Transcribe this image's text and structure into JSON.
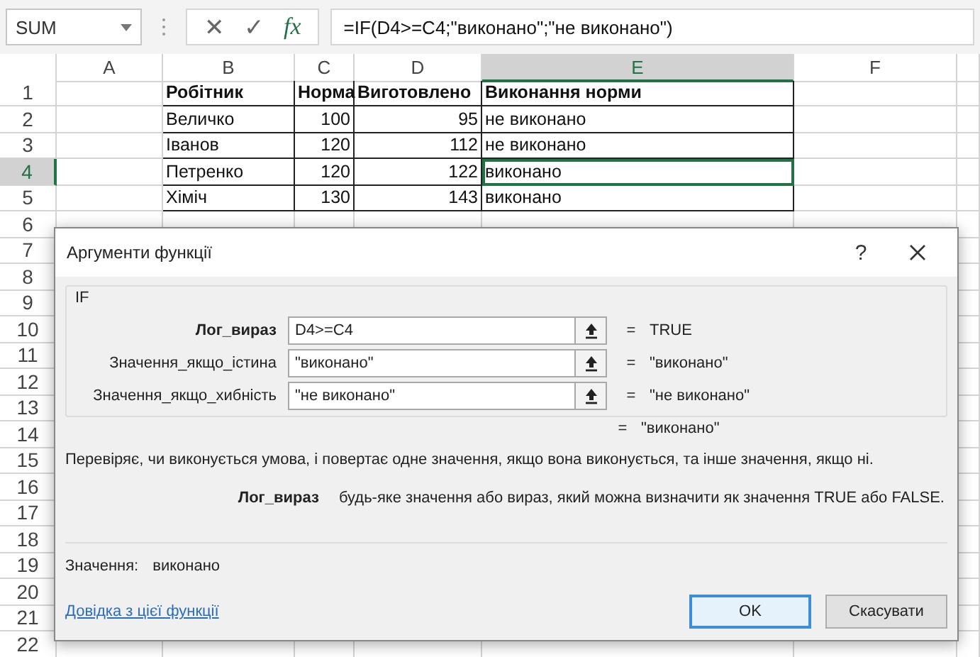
{
  "name_box": {
    "value": "SUM"
  },
  "formula_bar": {
    "cancel_glyph": "✕",
    "enter_glyph": "✓",
    "fx_glyph": "fx",
    "formula": "=IF(D4>=C4;\"виконано\";\"не виконано\")"
  },
  "columns": [
    {
      "label": "A",
      "selected": false
    },
    {
      "label": "B",
      "selected": false
    },
    {
      "label": "C",
      "selected": false
    },
    {
      "label": "D",
      "selected": false
    },
    {
      "label": "E",
      "selected": true
    },
    {
      "label": "F",
      "selected": false
    }
  ],
  "rows": [
    {
      "label": "1",
      "selected": false,
      "cells": [
        "",
        "Робітник",
        "Норма",
        "Виготовлено",
        "Виконання норми",
        ""
      ]
    },
    {
      "label": "2",
      "selected": false,
      "cells": [
        "",
        "Величко",
        "100",
        "95",
        "не виконано",
        ""
      ]
    },
    {
      "label": "3",
      "selected": false,
      "cells": [
        "",
        "Іванов",
        "120",
        "112",
        "не виконано",
        ""
      ]
    },
    {
      "label": "4",
      "selected": true,
      "cells": [
        "",
        "Петренко",
        "120",
        "122",
        "виконано",
        ""
      ]
    },
    {
      "label": "5",
      "selected": false,
      "cells": [
        "",
        "Хіміч",
        "130",
        "143",
        "виконано",
        ""
      ]
    },
    {
      "label": "6",
      "selected": false
    },
    {
      "label": "7",
      "selected": false
    },
    {
      "label": "8",
      "selected": false
    },
    {
      "label": "9",
      "selected": false
    },
    {
      "label": "10",
      "selected": false
    },
    {
      "label": "11",
      "selected": false
    },
    {
      "label": "12",
      "selected": false
    },
    {
      "label": "13",
      "selected": false
    },
    {
      "label": "14",
      "selected": false
    },
    {
      "label": "15",
      "selected": false
    },
    {
      "label": "16",
      "selected": false
    },
    {
      "label": "17",
      "selected": false
    },
    {
      "label": "18",
      "selected": false
    },
    {
      "label": "19",
      "selected": false
    },
    {
      "label": "20",
      "selected": false
    },
    {
      "label": "21",
      "selected": false
    },
    {
      "label": "22",
      "selected": false
    }
  ],
  "dialog": {
    "title": "Аргументи функції",
    "help_glyph": "?",
    "function_name": "IF",
    "arguments": [
      {
        "label": "Лог_вираз",
        "current": true,
        "value": "D4>=C4",
        "result": "TRUE"
      },
      {
        "label": "Значення_якщо_істина",
        "current": false,
        "value": "\"виконано\"",
        "result": "\"виконано\""
      },
      {
        "label": "Значення_якщо_хибність",
        "current": false,
        "value": "\"не виконано\"",
        "result": "\"не виконано\""
      }
    ],
    "equals_glyph": "=",
    "formula_result": "\"виконано\"",
    "description": "Перевіряє, чи виконується умова, і повертає одне значення, якщо вона виконується, та інше значення, якщо ні.",
    "argument_name": "Лог_вираз",
    "argument_help": "будь-яке значення або вираз, який можна визначити як значення TRUE або FALSE.",
    "value_label": "Значення:",
    "value": "виконано",
    "help_link": "Довідка з цієї функції",
    "buttons": [
      {
        "label": "OK",
        "kind": "primary"
      },
      {
        "label": "Скасувати",
        "kind": "secondary"
      }
    ]
  }
}
